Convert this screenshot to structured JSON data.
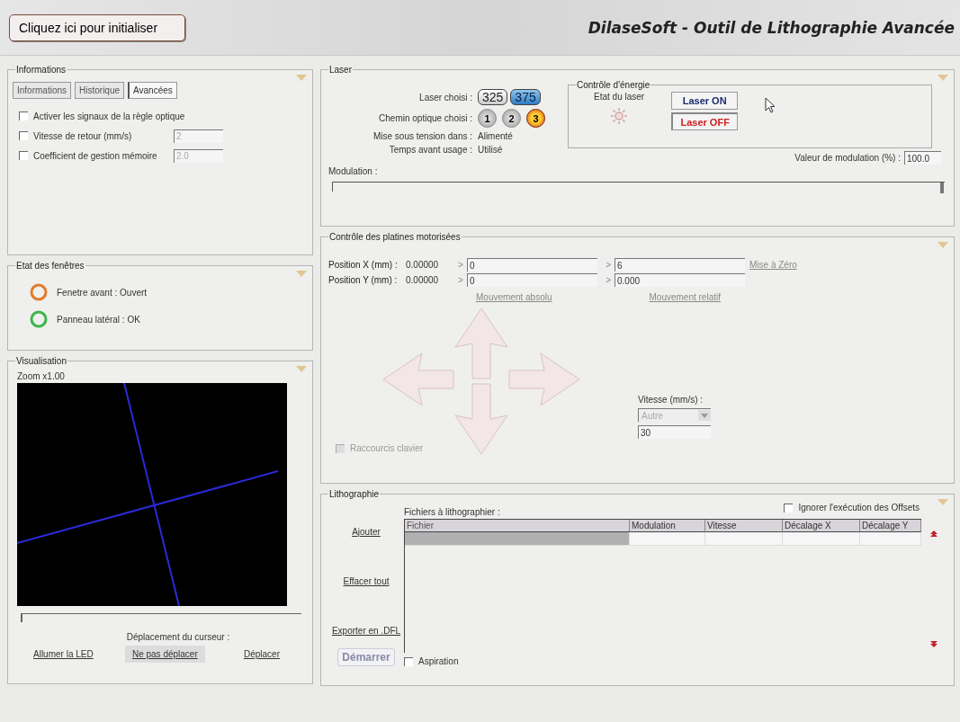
{
  "header": {
    "init_button": "Cliquez ici pour initialiser",
    "title": "DilaseSoft - Outil de Lithographie Avancée"
  },
  "informations": {
    "title": "Informations",
    "tabs": [
      {
        "label": "Informations",
        "selected": false
      },
      {
        "label": "Historique",
        "selected": false
      },
      {
        "label": "Avancées",
        "selected": true
      }
    ],
    "options": [
      {
        "label": "Activer les signaux de la règle optique",
        "checked": false
      },
      {
        "label": "Vitesse de retour (mm/s)",
        "checked": false,
        "value": "2"
      },
      {
        "label": "Coefficient de gestion mémoire",
        "checked": false,
        "value": "2.0"
      }
    ]
  },
  "window_state": {
    "title": "Etat des fenêtres",
    "items": [
      {
        "label": "Fenetre avant : Ouvert",
        "color": "#e07b2a"
      },
      {
        "label": "Panneau latéral : OK",
        "color": "#3cb54a"
      }
    ]
  },
  "visualisation": {
    "title": "Visualisation",
    "zoom": "Zoom x1.00",
    "slider": {
      "level": 0
    },
    "cursor_label": "Déplacement du curseur :",
    "led_link": "Allumer la LED",
    "cursor_options": [
      {
        "label": "Ne pas déplacer",
        "selected": true
      },
      {
        "label": "Déplacer",
        "selected": false
      }
    ]
  },
  "laser": {
    "title": "Laser",
    "laser_label": "Laser choisi :",
    "lasers": [
      {
        "label": "325",
        "selected": false
      },
      {
        "label": "375",
        "selected": true
      }
    ],
    "path_label": "Chemin optique choisi :",
    "paths": [
      {
        "label": "1",
        "selected": false
      },
      {
        "label": "2",
        "selected": false
      },
      {
        "label": "3",
        "selected": true
      }
    ],
    "power_label": "Mise sous tension dans :",
    "power_value": "Alimenté",
    "time_label": "Temps avant usage :",
    "time_value": "Utilisé",
    "energy": {
      "title": "Contrôle d'énergie",
      "state_label": "Etat du laser",
      "buttons": [
        {
          "label": "Laser ON",
          "kind": "on"
        },
        {
          "label": "Laser OFF",
          "kind": "off"
        }
      ]
    },
    "modulation_value_label": "Valeur de modulation (%) :",
    "modulation_value": "100.0",
    "modulation_label": "Modulation :",
    "modulation": {
      "level": 1
    }
  },
  "stages": {
    "title": "Contrôle des platines motorisées",
    "rows": [
      {
        "label": "Position X (mm) :",
        "reading": "0.00000",
        "absolute_prefix": ">",
        "absolute": "0",
        "relative_prefix": ">",
        "relative": "6"
      },
      {
        "label": "Position Y (mm) :",
        "reading": "0.00000",
        "absolute_prefix": ">",
        "absolute": "0",
        "relative_prefix": ">",
        "relative": "0.000"
      }
    ],
    "zero_link": "Mise à Zéro",
    "absolute_link": "Mouvement absolu",
    "relative_link": "Mouvement relatif",
    "speed_label": "Vitesse (mm/s) :",
    "speed_select": "Autre",
    "speed_value": "30",
    "shortcut": {
      "label": "Raccourcis clavier",
      "checked": false,
      "disabled": true
    }
  },
  "lithography": {
    "title": "Lithographie",
    "ignore_offsets": {
      "label": "Ignorer l'exécution des Offsets",
      "checked": false
    },
    "files_label": "Fichiers à lithographier :",
    "actions": [
      "Ajouter",
      "Effacer tout",
      "Exporter en .DFL"
    ],
    "columns": [
      "Fichier",
      "Modulation",
      "Vitesse",
      "Décalage X",
      "Décalage Y"
    ],
    "start_button": {
      "label": "Démarrer",
      "disabled": true
    },
    "aspiration": {
      "label": "Aspiration",
      "checked": false
    }
  }
}
